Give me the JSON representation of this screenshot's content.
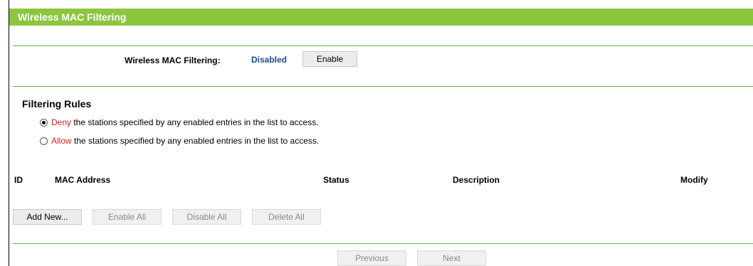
{
  "header": {
    "title": "Wireless MAC Filtering"
  },
  "mac_filtering": {
    "label": "Wireless MAC Filtering:",
    "status": "Disabled",
    "enable_button": "Enable"
  },
  "filtering_rules": {
    "title": "Filtering Rules",
    "options": [
      {
        "keyword": "Deny",
        "rest": " the stations specified by any enabled entries in the list to access.",
        "checked": true
      },
      {
        "keyword": "Allow",
        "rest": " the stations specified by any enabled entries in the list to access.",
        "checked": false
      }
    ]
  },
  "table": {
    "columns": [
      "ID",
      "MAC Address",
      "Status",
      "Description",
      "Modify"
    ],
    "rows": []
  },
  "actions": {
    "add_new": "Add New...",
    "enable_all": "Enable All",
    "disable_all": "Disable All",
    "delete_all": "Delete All"
  },
  "pagination": {
    "previous": "Previous",
    "next": "Next"
  },
  "colors": {
    "header_bg": "#8cc63f",
    "divider": "#66a84a",
    "status_text": "#1a4a8a",
    "keyword": "#e01e1e"
  }
}
